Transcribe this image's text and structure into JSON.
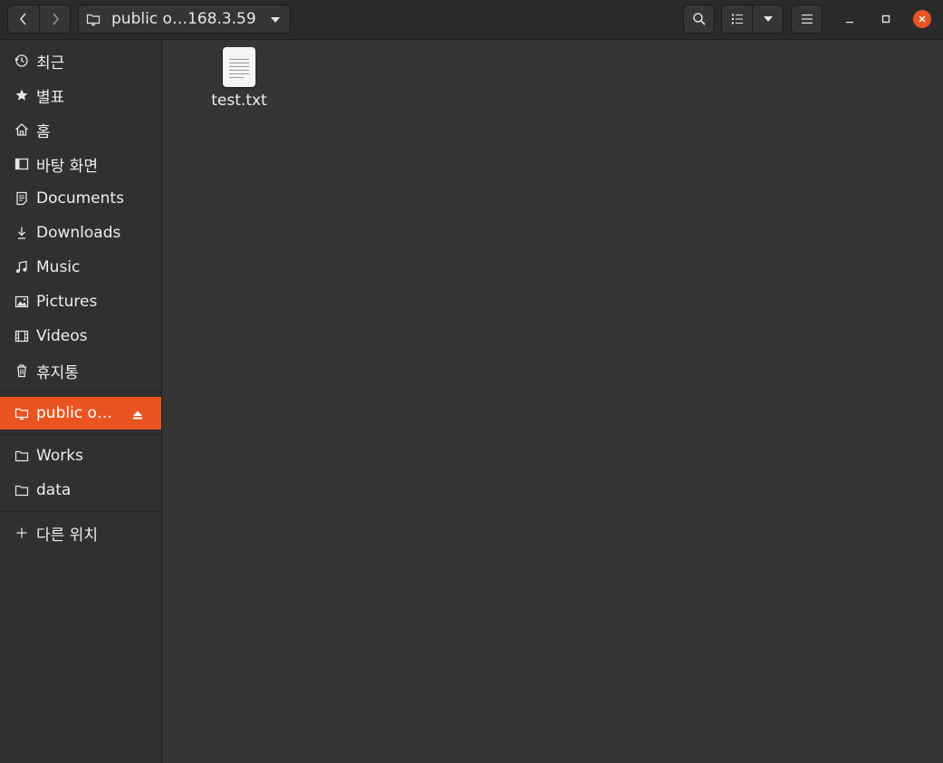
{
  "header": {
    "path_label": "public o…168.3.59"
  },
  "sidebar": {
    "items": [
      {
        "label": "최근",
        "icon": "clock-icon"
      },
      {
        "label": "별표",
        "icon": "star-icon"
      },
      {
        "label": "홈",
        "icon": "home-icon"
      },
      {
        "label": "바탕 화면",
        "icon": "desktop-icon"
      },
      {
        "label": "Documents",
        "icon": "document-icon"
      },
      {
        "label": "Downloads",
        "icon": "download-icon"
      },
      {
        "label": "Music",
        "icon": "music-icon"
      },
      {
        "label": "Pictures",
        "icon": "picture-icon"
      },
      {
        "label": "Videos",
        "icon": "video-icon"
      },
      {
        "label": "휴지통",
        "icon": "trash-icon"
      }
    ],
    "network": {
      "label": "public o…",
      "icon": "network-folder-icon",
      "active": true
    },
    "bookmarks": [
      {
        "label": "Works",
        "icon": "folder-icon"
      },
      {
        "label": "data",
        "icon": "folder-icon"
      }
    ],
    "other_locations": {
      "label": "다른 위치",
      "icon": "plus-icon"
    }
  },
  "files": [
    {
      "name": "test.txt",
      "icon": "text-file-icon"
    }
  ],
  "colors": {
    "accent": "#e95420"
  }
}
